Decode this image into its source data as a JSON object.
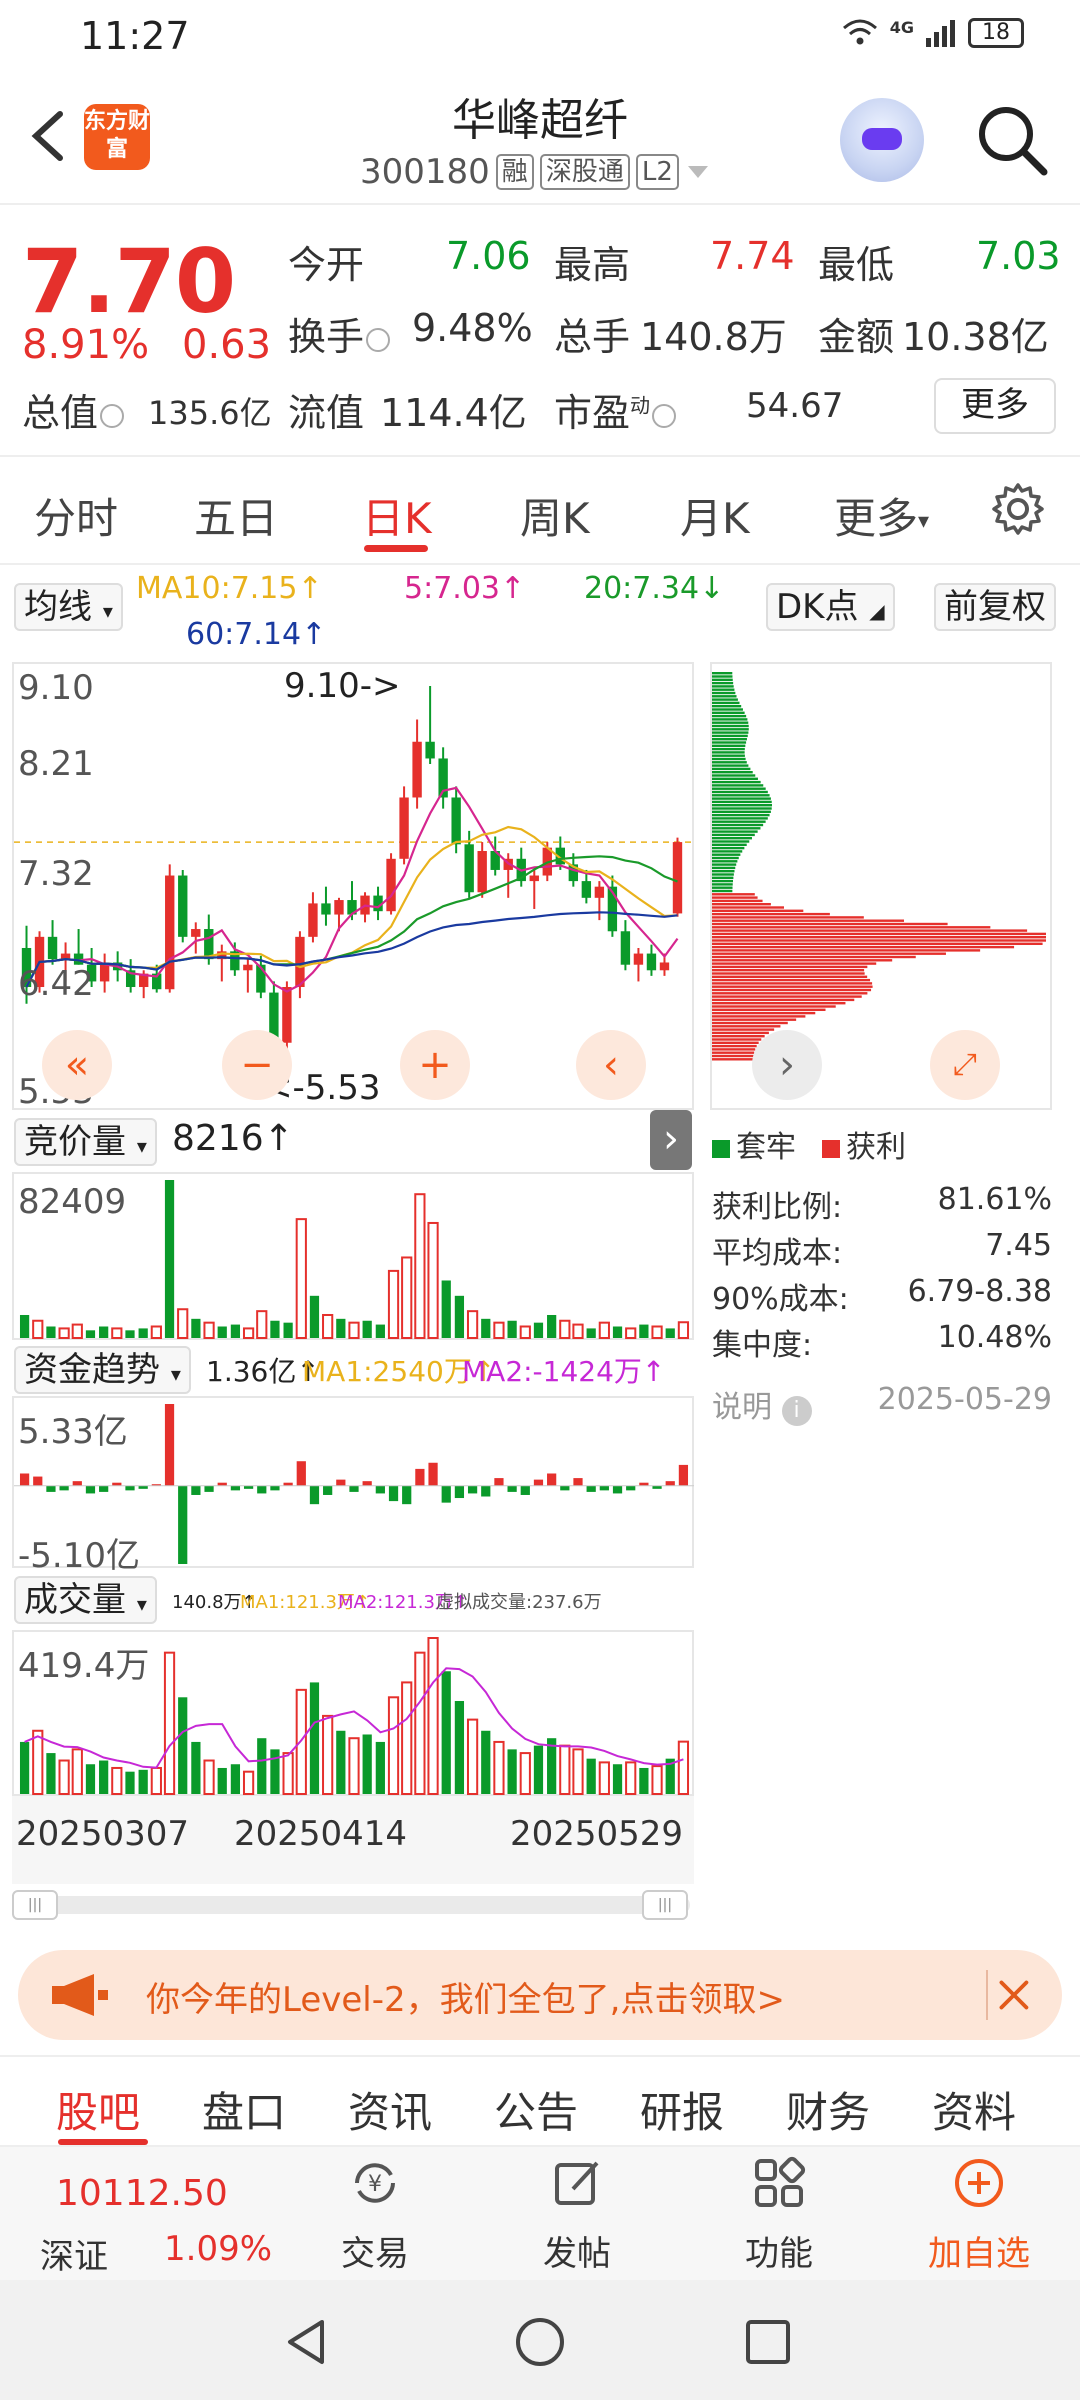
{
  "status_bar": {
    "time": "11:27",
    "network": "4G",
    "battery": "18"
  },
  "header": {
    "brand_logo_text": "东方财富",
    "stock_name": "华峰超纤",
    "stock_code": "300180",
    "tags": [
      "融",
      "深股通",
      "L2"
    ]
  },
  "quote": {
    "price": "7.70",
    "change_pct": "8.91%",
    "change_amt": "0.63",
    "open_label": "今开",
    "open": "7.06",
    "high_label": "最高",
    "high": "7.74",
    "low_label": "最低",
    "low": "7.03",
    "turnover_label": "换手",
    "turnover": "9.48%",
    "volume_label": "总手",
    "volume": "140.8万",
    "amount_label": "金额",
    "amount": "10.38亿",
    "mktcap_label": "总值",
    "mktcap": "135.6亿",
    "float_label": "流值",
    "float_cap": "114.4亿",
    "pe_label": "市盈",
    "pe_sup": "动",
    "pe": "54.67",
    "more_label": "更多"
  },
  "period_tabs": [
    "分时",
    "五日",
    "日K",
    "周K",
    "月K",
    "更多"
  ],
  "ma_row": {
    "indicator_select": "均线",
    "ma10": "MA10:7.15↑",
    "ma5": "5:7.03↑",
    "ma20": "20:7.34↓",
    "ma60": "60:7.14↑",
    "dk_select": "DK点",
    "adjust_select": "前复权"
  },
  "kline": {
    "price_labels": [
      "9.10",
      "8.21",
      "7.32",
      "6.42",
      "5.53"
    ],
    "high_marker": "9.10->",
    "low_marker": "<-5.53"
  },
  "auction": {
    "label": "竞价量",
    "value": "8216↑",
    "axis_max": "82409"
  },
  "fund_trend": {
    "label": "资金趋势",
    "value": "1.36亿↑",
    "ma1": "MA1:2540万↑",
    "ma2": "MA2:-1424万↑",
    "axis_max": "5.33亿",
    "axis_min": "-5.10亿"
  },
  "volume_panel": {
    "label": "成交量",
    "value": "140.8万↑",
    "ma1": "MA1:121.3万↑",
    "ma2": "MA2:121.3万↑",
    "virtual": "虚拟成交量:237.6万",
    "axis_max": "419.4万"
  },
  "dates": [
    "20250307",
    "20250414",
    "20250529"
  ],
  "chip": {
    "legend_trapped": "套牢",
    "legend_profit": "获利",
    "profit_ratio_label": "获利比例:",
    "profit_ratio": "81.61%",
    "avg_cost_label": "平均成本:",
    "avg_cost": "7.45",
    "cost90_label": "90%成本:",
    "cost90": "6.79-8.38",
    "concentration_label": "集中度:",
    "concentration": "10.48%",
    "note_label": "说明",
    "note_date": "2025-05-29"
  },
  "banner": {
    "text": "你今年的Level-2，我们全包了,点击领取>"
  },
  "info_tabs": [
    "股吧",
    "盘口",
    "资讯",
    "公告",
    "研报",
    "财务",
    "资料"
  ],
  "bottom_bar": {
    "index_value": "10112.50",
    "index_name": "深证",
    "index_change": "1.09%",
    "trade": "交易",
    "post": "发帖",
    "features": "功能",
    "add_watch": "加自选"
  },
  "colors": {
    "up": "#e5302c",
    "down": "#0a9a2a",
    "accent": "#f25a1d"
  },
  "chart_data": [
    {
      "type": "candlestick",
      "title": "日K",
      "x_start": "20250307",
      "x_end": "20250529",
      "ylim": [
        5.53,
        9.1
      ],
      "ohlc": [
        [
          6.75,
          6.95,
          6.25,
          6.4
        ],
        [
          6.4,
          6.9,
          6.35,
          6.85
        ],
        [
          6.85,
          7.0,
          6.6,
          6.65
        ],
        [
          6.65,
          6.8,
          6.45,
          6.7
        ],
        [
          6.7,
          6.92,
          6.6,
          6.6
        ],
        [
          6.6,
          6.75,
          6.4,
          6.45
        ],
        [
          6.45,
          6.7,
          6.35,
          6.62
        ],
        [
          6.62,
          6.72,
          6.45,
          6.55
        ],
        [
          6.55,
          6.65,
          6.35,
          6.4
        ],
        [
          6.4,
          6.55,
          6.3,
          6.52
        ],
        [
          6.52,
          6.6,
          6.35,
          6.38
        ],
        [
          6.38,
          7.5,
          6.35,
          7.4
        ],
        [
          7.4,
          7.45,
          6.8,
          6.85
        ],
        [
          6.85,
          6.98,
          6.7,
          6.92
        ],
        [
          6.92,
          7.05,
          6.6,
          6.65
        ],
        [
          6.65,
          6.78,
          6.45,
          6.72
        ],
        [
          6.72,
          6.8,
          6.5,
          6.55
        ],
        [
          6.55,
          6.65,
          6.35,
          6.6
        ],
        [
          6.6,
          6.68,
          6.3,
          6.35
        ],
        [
          6.35,
          6.45,
          5.53,
          5.9
        ],
        [
          5.9,
          6.45,
          5.8,
          6.4
        ],
        [
          6.4,
          6.9,
          6.3,
          6.85
        ],
        [
          6.85,
          7.25,
          6.8,
          7.15
        ],
        [
          7.15,
          7.3,
          6.95,
          7.05
        ],
        [
          7.05,
          7.2,
          6.9,
          7.18
        ],
        [
          7.18,
          7.35,
          7.0,
          7.05
        ],
        [
          7.05,
          7.25,
          6.98,
          7.22
        ],
        [
          7.22,
          7.3,
          7.0,
          7.08
        ],
        [
          7.08,
          7.6,
          7.05,
          7.55
        ],
        [
          7.55,
          8.2,
          7.5,
          8.1
        ],
        [
          8.1,
          8.8,
          8.0,
          8.6
        ],
        [
          8.6,
          9.1,
          8.4,
          8.45
        ],
        [
          8.45,
          8.55,
          8.0,
          8.1
        ],
        [
          8.1,
          8.2,
          7.6,
          7.68
        ],
        [
          7.68,
          7.8,
          7.2,
          7.25
        ],
        [
          7.25,
          7.7,
          7.2,
          7.62
        ],
        [
          7.62,
          7.75,
          7.4,
          7.45
        ],
        [
          7.45,
          7.6,
          7.2,
          7.55
        ],
        [
          7.55,
          7.65,
          7.3,
          7.35
        ],
        [
          7.35,
          7.45,
          7.1,
          7.4
        ],
        [
          7.4,
          7.7,
          7.35,
          7.65
        ],
        [
          7.65,
          7.75,
          7.45,
          7.5
        ],
        [
          7.5,
          7.6,
          7.3,
          7.35
        ],
        [
          7.35,
          7.45,
          7.15,
          7.2
        ],
        [
          7.2,
          7.35,
          7.0,
          7.3
        ],
        [
          7.3,
          7.4,
          6.85,
          6.9
        ],
        [
          6.9,
          7.0,
          6.55,
          6.6
        ],
        [
          6.6,
          6.75,
          6.45,
          6.7
        ],
        [
          6.7,
          6.78,
          6.5,
          6.55
        ],
        [
          6.55,
          6.7,
          6.5,
          6.62
        ],
        [
          7.06,
          7.74,
          7.03,
          7.7
        ]
      ]
    },
    {
      "type": "bar",
      "title": "竞价量",
      "ylim": [
        0,
        82409
      ],
      "values": [
        12000,
        9000,
        6000,
        5000,
        7000,
        4000,
        6000,
        5000,
        4000,
        5000,
        6000,
        82409,
        15000,
        10000,
        8000,
        6000,
        7000,
        5000,
        14000,
        9000,
        8000,
        62000,
        22000,
        12000,
        10000,
        8000,
        9000,
        7000,
        35000,
        42000,
        75000,
        60000,
        30000,
        22000,
        14000,
        10000,
        8000,
        9000,
        6000,
        8000,
        12000,
        9000,
        7000,
        5000,
        8000,
        6000,
        5000,
        7000,
        6000,
        5000,
        8216
      ],
      "up": [
        false,
        true,
        false,
        true,
        true,
        false,
        false,
        true,
        false,
        false,
        true,
        false,
        true,
        false,
        true,
        false,
        false,
        true,
        true,
        false,
        false,
        true,
        false,
        true,
        false,
        true,
        false,
        false,
        true,
        true,
        true,
        true,
        false,
        false,
        true,
        false,
        true,
        false,
        true,
        false,
        false,
        true,
        true,
        false,
        true,
        false,
        true,
        false,
        true,
        false,
        true
      ]
    },
    {
      "type": "bar",
      "title": "资金趋势",
      "ylim": [
        -5.1,
        5.33
      ],
      "values": [
        0.8,
        0.6,
        -0.4,
        -0.3,
        0.3,
        -0.5,
        -0.4,
        0.2,
        -0.3,
        -0.2,
        0.1,
        5.33,
        -5.1,
        -0.6,
        -0.4,
        0.2,
        -0.3,
        -0.2,
        -0.5,
        -0.3,
        0.2,
        1.6,
        -1.2,
        -0.6,
        0.4,
        -0.4,
        0.3,
        -0.5,
        -1.0,
        -1.2,
        1.1,
        1.5,
        -1.1,
        -0.8,
        -0.5,
        -0.7,
        0.5,
        -0.4,
        -0.6,
        0.4,
        0.8,
        -0.3,
        0.5,
        -0.4,
        -0.3,
        -0.5,
        -0.3,
        0.2,
        -0.2,
        0.3,
        1.36
      ]
    },
    {
      "type": "bar",
      "title": "成交量",
      "ylim": [
        0,
        419.4
      ],
      "values": [
        140,
        170,
        110,
        90,
        120,
        80,
        90,
        70,
        60,
        65,
        70,
        380,
        260,
        140,
        90,
        70,
        80,
        60,
        150,
        120,
        110,
        280,
        300,
        210,
        170,
        150,
        160,
        140,
        260,
        300,
        380,
        419.4,
        330,
        250,
        200,
        170,
        140,
        120,
        110,
        130,
        150,
        130,
        120,
        95,
        85,
        80,
        85,
        70,
        75,
        95,
        140.8
      ],
      "up": [
        false,
        true,
        false,
        true,
        true,
        false,
        false,
        true,
        false,
        false,
        true,
        true,
        false,
        false,
        true,
        false,
        false,
        true,
        false,
        false,
        true,
        true,
        false,
        true,
        false,
        true,
        false,
        false,
        true,
        true,
        true,
        true,
        false,
        false,
        true,
        false,
        true,
        false,
        true,
        false,
        false,
        true,
        true,
        false,
        true,
        false,
        true,
        false,
        true,
        false,
        true
      ]
    }
  ]
}
